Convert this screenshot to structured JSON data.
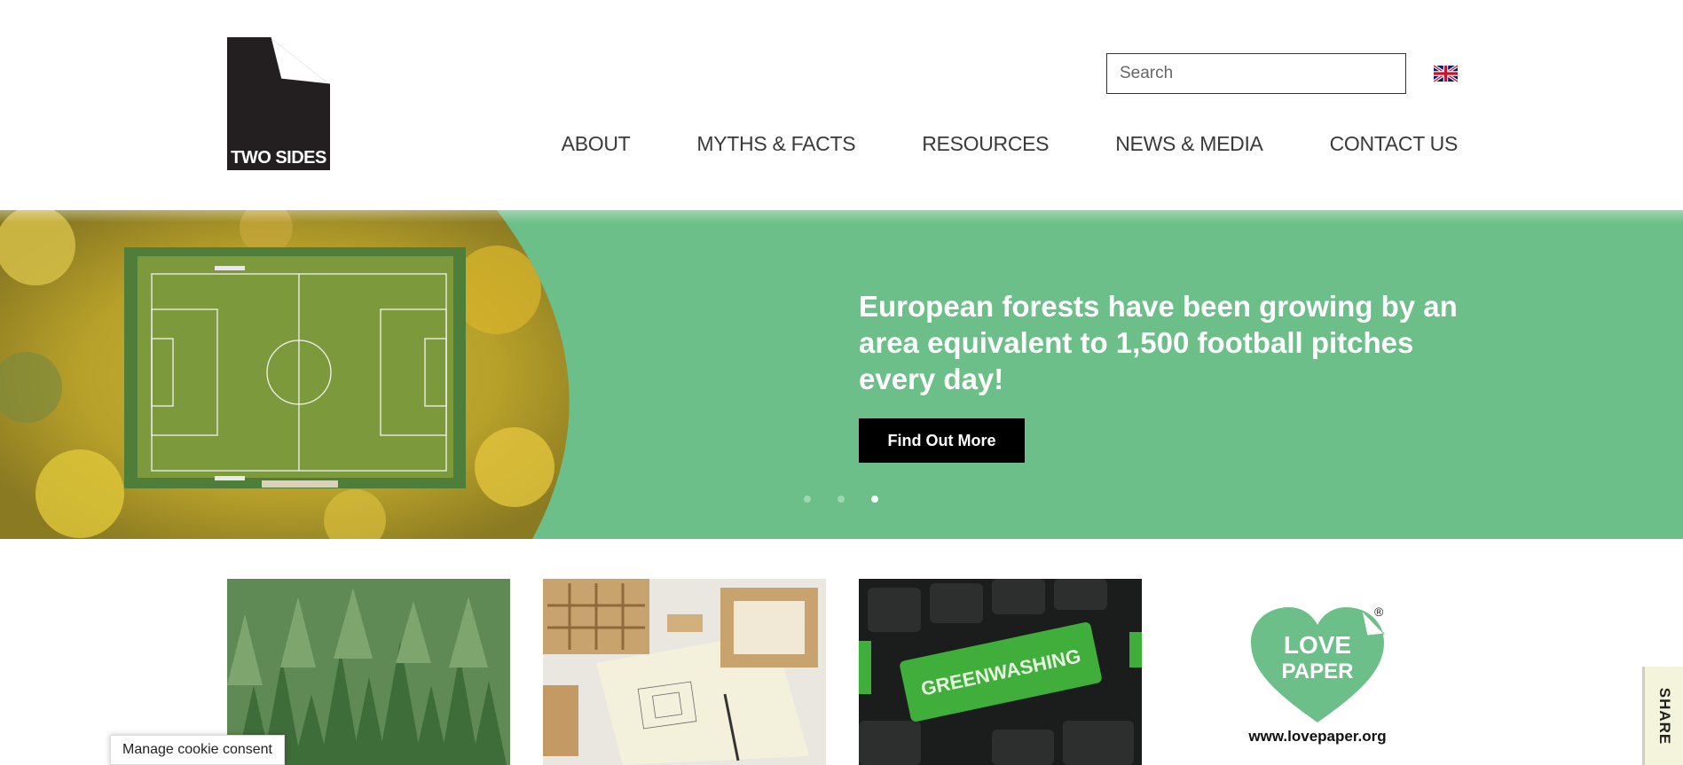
{
  "brand": {
    "logo_text": "TWO SIDES"
  },
  "header": {
    "search_placeholder": "Search",
    "language_icon": "uk-flag-icon",
    "nav": [
      {
        "label": "ABOUT"
      },
      {
        "label": "MYTHS & FACTS"
      },
      {
        "label": "RESOURCES"
      },
      {
        "label": "NEWS & MEDIA"
      },
      {
        "label": "CONTACT US"
      }
    ]
  },
  "hero": {
    "headline": "European forests have been growing by an area equivalent to 1,500 football pitches every day!",
    "button_label": "Find Out More",
    "background_color": "#6dbf89",
    "slides_total": 3,
    "active_slide": 3
  },
  "cards": {
    "greenwashing_text": "GREENWASHING"
  },
  "love_paper": {
    "logo_line1": "LOVE",
    "logo_line2": "PAPER",
    "url": "www.lovepaper.org"
  },
  "cookie": {
    "label": "Manage cookie consent"
  },
  "share": {
    "label": "SHARE"
  }
}
